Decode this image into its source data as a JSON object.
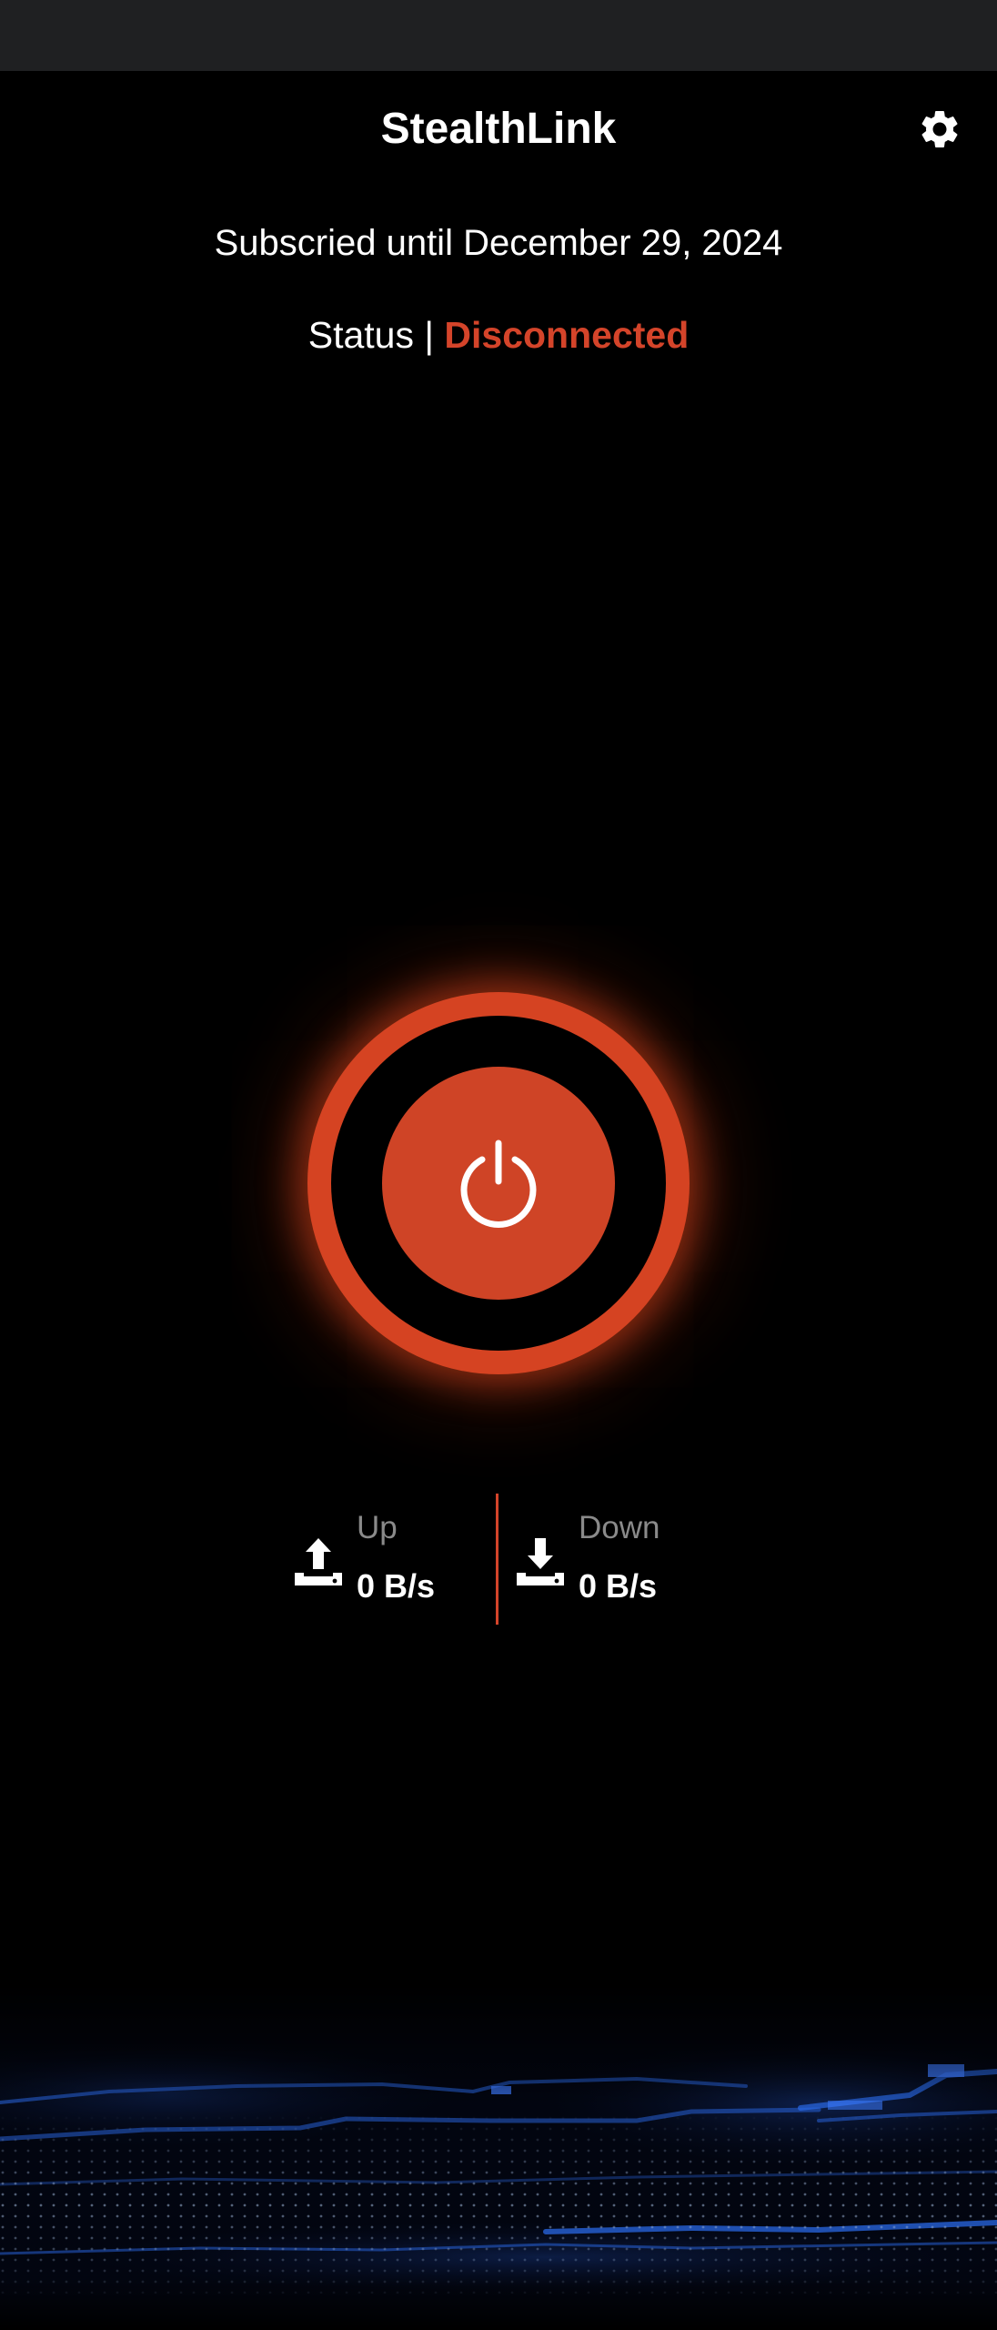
{
  "app": {
    "title": "StealthLink"
  },
  "subscription": {
    "text": "Subscried until December 29, 2024"
  },
  "status": {
    "label": "Status | ",
    "value": "Disconnected"
  },
  "power_button": {
    "icon": "power-icon"
  },
  "stats": {
    "up": {
      "label": "Up",
      "value": "0 B/s",
      "icon": "upload-icon"
    },
    "down": {
      "label": "Down",
      "value": "0 B/s",
      "icon": "download-icon"
    }
  },
  "settings": {
    "icon": "gear-icon"
  },
  "colors": {
    "accent": "#D4442A",
    "background": "#000000",
    "status_bar": "#1F2022",
    "muted_text": "#8A8A8A",
    "decor_blue": "#1E5FD8"
  }
}
